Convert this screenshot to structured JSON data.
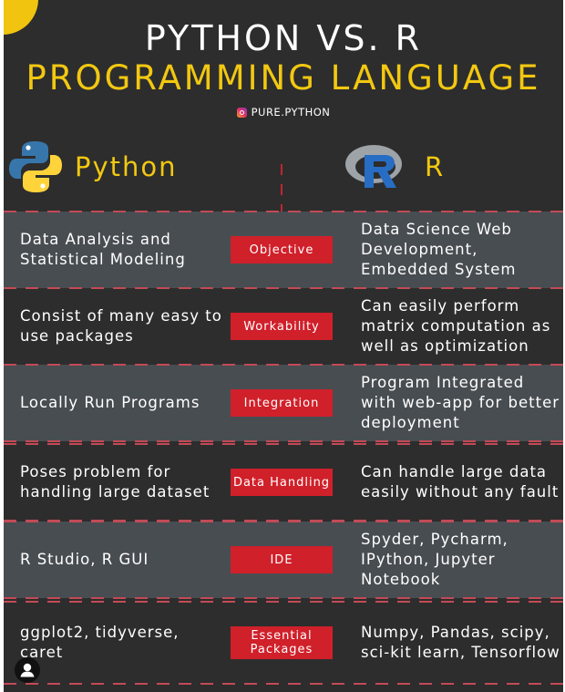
{
  "header": {
    "title_line1": "PYTHON VS. R",
    "title_line2": "PROGRAMMING LANGUAGE",
    "handle": "PURE.PYTHON",
    "handle_icon": "instagram-icon"
  },
  "languages": {
    "left": {
      "name": "Python",
      "icon": "python-logo-icon",
      "colors": [
        "#3776ab",
        "#ffd43b"
      ]
    },
    "right": {
      "name": "R",
      "icon": "r-logo-icon",
      "colors": [
        "#276dc3",
        "#a6a6a6"
      ]
    }
  },
  "colors": {
    "background": "#2d2d2d",
    "band": "#484d52",
    "accent_yellow": "#f2c811",
    "badge_red": "#d0202a"
  },
  "rows": [
    {
      "category": "Objective",
      "python": "Data Analysis and Statistical Modeling",
      "r": "Data Science Web Development, Embedded System"
    },
    {
      "category": "Workability",
      "python": "Consist of many easy to use packages",
      "r": "Can easily perform matrix computation as well as optimization"
    },
    {
      "category": "Integration",
      "python": "Locally Run Programs",
      "r": "Program Integrated with web-app for better deployment"
    },
    {
      "category": "Data Handling",
      "python": "Poses problem for handling large dataset",
      "r": "Can handle large data easily without any fault"
    },
    {
      "category": "IDE",
      "python": "R Studio, R GUI",
      "r": "Spyder, Pycharm, IPython, Jupyter Notebook"
    },
    {
      "category": "Essential Packages",
      "python": "ggplot2, tidyverse, caret",
      "r": "Numpy, Pandas, scipy, sci-kit learn, Tensorflow"
    }
  ]
}
